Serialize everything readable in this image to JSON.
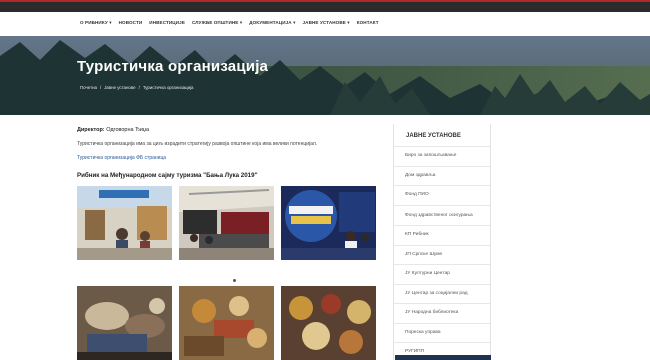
{
  "nav": {
    "items": [
      "О РИБНИКУ ▾",
      "НОВОСТИ",
      "ИНВЕСТИЦИЈЕ",
      "СЛУЖБЕ ОПШТИНЕ ▾",
      "ДОКУМЕНТАЦИЈА ▾",
      "ЈАВНЕ УСТАНОВЕ ▾",
      "КОНТАКТ"
    ]
  },
  "hero": {
    "title": "Туристичка организација",
    "breadcrumb": [
      "Почетна",
      "/",
      "Јавне установе",
      "/",
      "Туристичка организација"
    ]
  },
  "main": {
    "director_label": "Директор:",
    "director_name": "Одговорна Ђиџа",
    "intro": "Туристичка организација има за циљ израдити стратегију развоја општине која има велики потенцијал.",
    "fb_link": "Туристичка организација ФБ страница",
    "gallery_title": "Рибник на Међународном сајму туризма \"Бања Лука 2019\""
  },
  "sidebar": {
    "title": "ЈАВНЕ УСТАНОВЕ",
    "items": [
      "Биро за запошљавање",
      "Дом здравља",
      "Фонд ПИО",
      "Фонд здравственог осигурања",
      "КП Рибник",
      "ЈП Српске Шуме",
      "ЈУ Културни Центар",
      "ЈУ Центар за социјални рад",
      "ЈУ Народна библиотека",
      "Пореска управа",
      "РУГИПП"
    ]
  },
  "colors": {
    "topbar": "#2b2b2b",
    "accent": "#b5262b",
    "hero_overlay": "#1c2c45",
    "sidebar_button": "#1f3350"
  }
}
